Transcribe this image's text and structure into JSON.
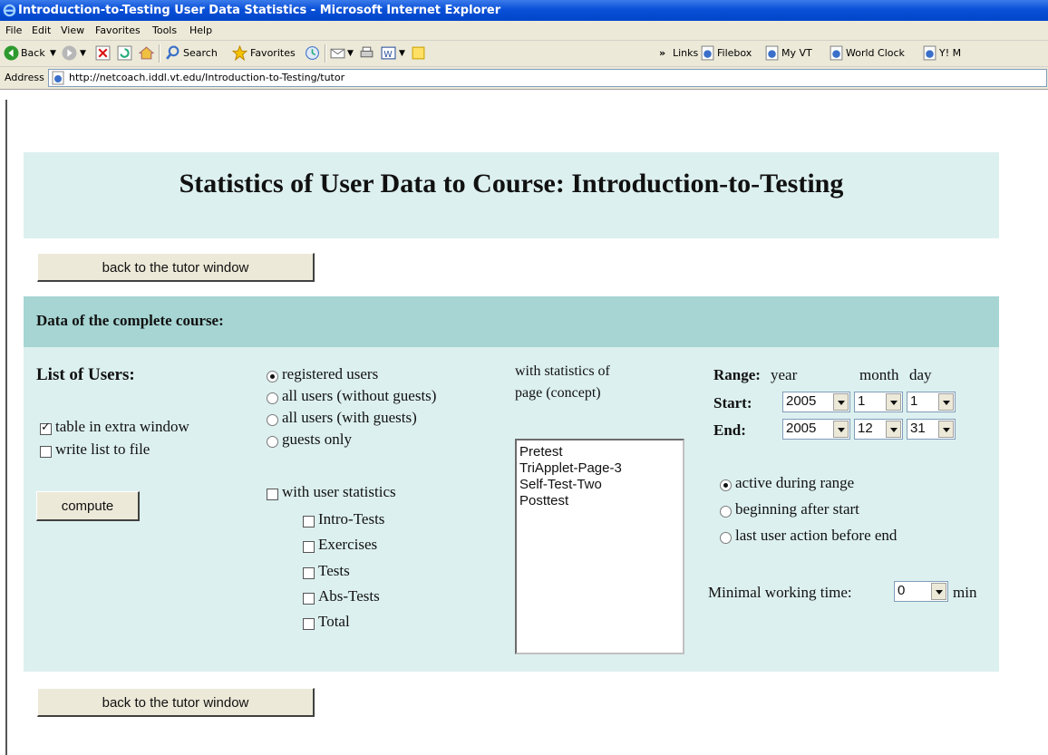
{
  "window": {
    "title": "Introduction-to-Testing User Data Statistics - Microsoft Internet Explorer"
  },
  "menu": [
    "File",
    "Edit",
    "View",
    "Favorites",
    "Tools",
    "Help"
  ],
  "toolbar": {
    "back": "Back",
    "search": "Search",
    "favorites": "Favorites",
    "overflow": "»",
    "links": "Links",
    "link_items": [
      "Filebox",
      "My VT",
      "World Clock",
      "Y! M"
    ]
  },
  "address": {
    "label": "Address",
    "url": "http://netcoach.iddl.vt.edu/Introduction-to-Testing/tutor"
  },
  "page": {
    "title": "Statistics of User Data to Course: Introduction-to-Testing",
    "back_button": "back to the tutor window",
    "section_header": "Data of the complete course:",
    "list_of_users": "List of Users:",
    "table_in_extra_window": "table in extra window",
    "write_list_to_file": "write list to file",
    "compute": "compute",
    "user_filter": [
      {
        "label": "registered users",
        "selected": true
      },
      {
        "label": "all users (without guests)",
        "selected": false
      },
      {
        "label": "all users (with guests)",
        "selected": false
      },
      {
        "label": "guests only",
        "selected": false
      }
    ],
    "with_user_statistics": "with user statistics",
    "stat_checks": [
      "Intro-Tests",
      "Exercises",
      "Tests",
      "Abs-Tests",
      "Total"
    ],
    "with_statistics_of": "with statistics of",
    "page_concept": "page (concept)",
    "pages": [
      "Pretest",
      "TriApplet-Page-3",
      "Self-Test-Two",
      "Posttest"
    ],
    "range_label": "Range:",
    "year": "year",
    "month": "month",
    "day": "day",
    "start_label": "Start:",
    "end_label": "End:",
    "start": {
      "year": "2005",
      "month": "1",
      "day": "1"
    },
    "end": {
      "year": "2005",
      "month": "12",
      "day": "31"
    },
    "range_mode": [
      {
        "label": "active during range",
        "selected": true
      },
      {
        "label": "beginning after start",
        "selected": false
      },
      {
        "label": "last user action before end",
        "selected": false
      }
    ],
    "min_working_time_label": "Minimal working time:",
    "min_working_time": "0",
    "min_unit": "min"
  }
}
